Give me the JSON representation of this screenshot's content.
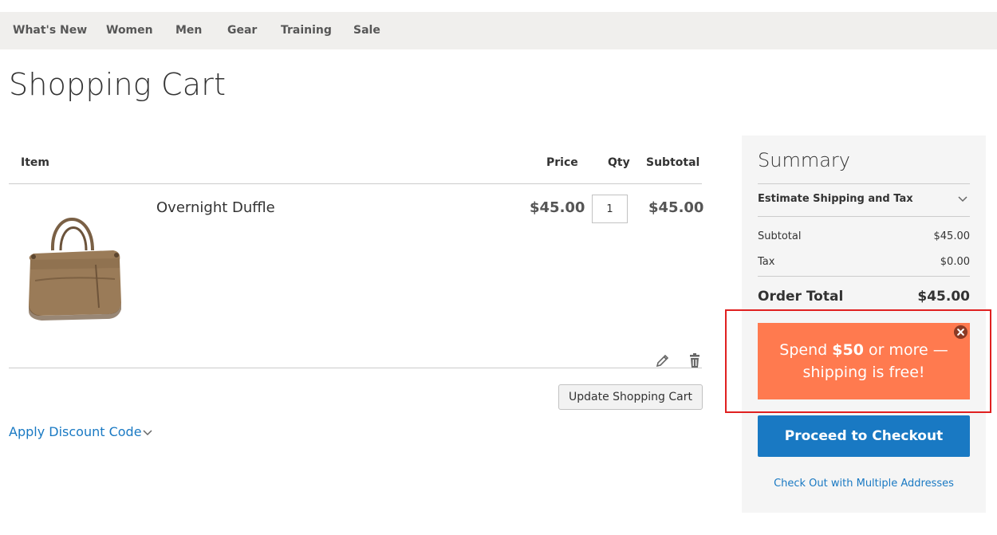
{
  "nav": {
    "items": [
      {
        "label": "What's New"
      },
      {
        "label": "Women"
      },
      {
        "label": "Men"
      },
      {
        "label": "Gear"
      },
      {
        "label": "Training"
      },
      {
        "label": "Sale"
      }
    ]
  },
  "page": {
    "title": "Shopping Cart"
  },
  "cart": {
    "headers": {
      "item": "Item",
      "price": "Price",
      "qty": "Qty",
      "subtotal": "Subtotal"
    },
    "items": [
      {
        "name": "Overnight Duffle",
        "price": "$45.00",
        "qty": "1",
        "subtotal": "$45.00",
        "image_icon": "duffle-bag-image"
      }
    ],
    "update_button": "Update Shopping Cart",
    "discount_label": "Apply Discount Code"
  },
  "summary": {
    "title": "Summary",
    "estimate_label": "Estimate Shipping and Tax",
    "subtotal_label": "Subtotal",
    "subtotal_value": "$45.00",
    "tax_label": "Tax",
    "tax_value": "$0.00",
    "order_total_label": "Order Total",
    "order_total_value": "$45.00",
    "promo": {
      "text_before": "Spend ",
      "amount": "$50",
      "text_after_line1": " or more —",
      "text_line2": "shipping is free!",
      "background": "#ff7a4f"
    },
    "checkout_button": "Proceed to Checkout",
    "multi_address_link": "Check Out with Multiple Addresses"
  },
  "colors": {
    "accent": "#1979c3",
    "promo": "#ff7a4f",
    "highlight_outline": "#e02020"
  }
}
